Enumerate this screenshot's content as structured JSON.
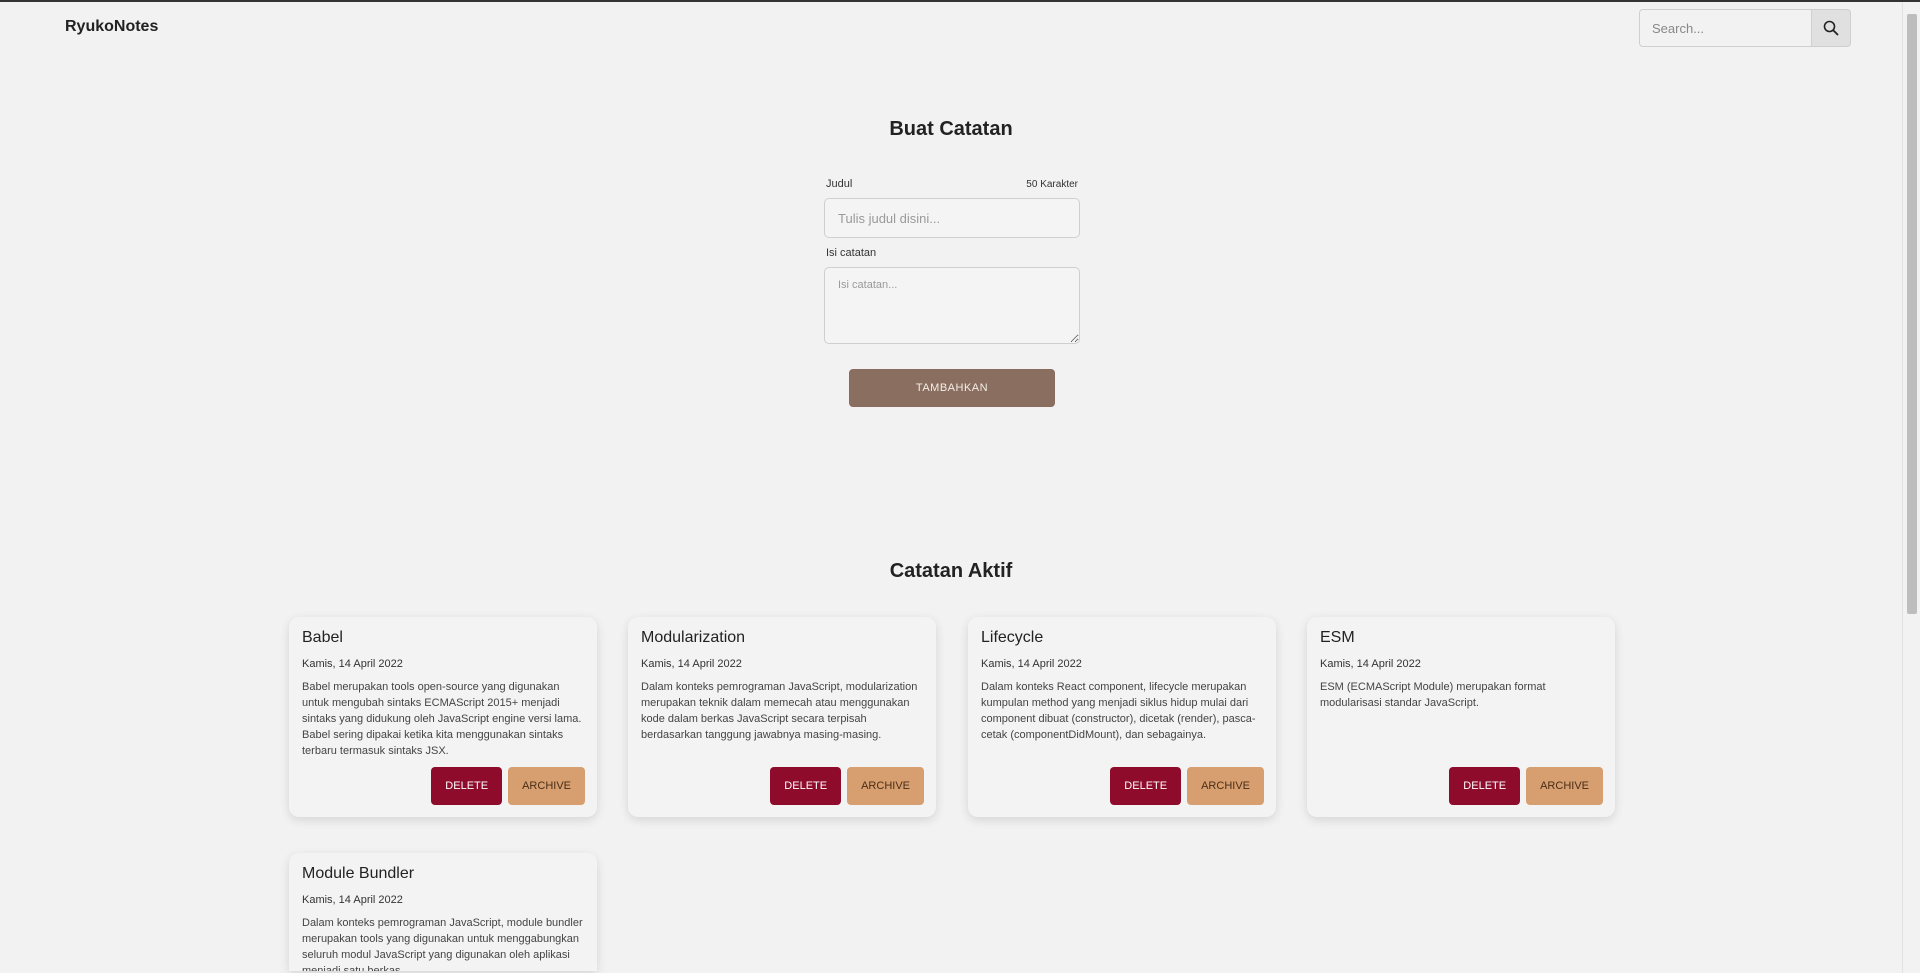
{
  "header": {
    "brand": "RyukoNotes",
    "search_placeholder": "Search..."
  },
  "create": {
    "title": "Buat Catatan",
    "title_label": "Judul",
    "char_counter": "50 Karakter",
    "title_placeholder": "Tulis judul disini...",
    "body_label": "Isi catatan",
    "body_placeholder": "Isi catatan...",
    "submit_label": "TAMBAHKAN"
  },
  "active": {
    "title": "Catatan Aktif",
    "delete_label": "DELETE",
    "archive_label": "ARCHIVE",
    "notes": [
      {
        "title": "Babel",
        "date": "Kamis, 14 April 2022",
        "body": "Babel merupakan tools open-source yang digunakan untuk mengubah sintaks ECMAScript 2015+ menjadi sintaks yang didukung oleh JavaScript engine versi lama. Babel sering dipakai ketika kita menggunakan sintaks terbaru termasuk sintaks JSX."
      },
      {
        "title": "Modularization",
        "date": "Kamis, 14 April 2022",
        "body": "Dalam konteks pemrograman JavaScript, modularization merupakan teknik dalam memecah atau menggunakan kode dalam berkas JavaScript secara terpisah berdasarkan tanggung jawabnya masing-masing."
      },
      {
        "title": "Lifecycle",
        "date": "Kamis, 14 April 2022",
        "body": "Dalam konteks React component, lifecycle merupakan kumpulan method yang menjadi siklus hidup mulai dari component dibuat (constructor), dicetak (render), pasca-cetak (componentDidMount), dan sebagainya."
      },
      {
        "title": "ESM",
        "date": "Kamis, 14 April 2022",
        "body": "ESM (ECMAScript Module) merupakan format modularisasi standar JavaScript."
      },
      {
        "title": "Module Bundler",
        "date": "Kamis, 14 April 2022",
        "body": "Dalam konteks pemrograman JavaScript, module bundler merupakan tools yang digunakan untuk menggabungkan seluruh modul JavaScript yang digunakan oleh aplikasi menjadi satu berkas."
      }
    ]
  },
  "colors": {
    "background": "#f2f2f2",
    "submit": "#8a6e5f",
    "delete": "#8f0b2b",
    "archive": "#d79f6f"
  },
  "icons": {
    "search": "search-icon"
  }
}
